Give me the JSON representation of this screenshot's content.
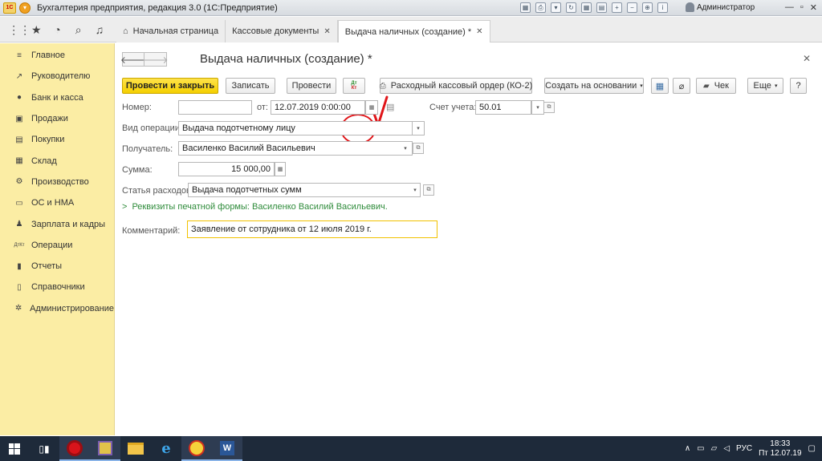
{
  "window": {
    "title": "Бухгалтерия предприятия, редакция 3.0  (1С:Предприятие)",
    "logo_text": "1С",
    "user": "Администратор",
    "controls": [
      "—",
      "▫",
      "✕"
    ]
  },
  "tabs": [
    {
      "label": "Начальная страница"
    },
    {
      "label": "Кассовые документы"
    },
    {
      "label": "Выдача наличных (создание) *"
    }
  ],
  "sidebar": {
    "items": [
      {
        "label": "Главное",
        "icon": "≡"
      },
      {
        "label": "Руководителю",
        "icon": "↗"
      },
      {
        "label": "Банк и касса",
        "icon": "●"
      },
      {
        "label": "Продажи",
        "icon": "▣"
      },
      {
        "label": "Покупки",
        "icon": "▤"
      },
      {
        "label": "Склад",
        "icon": "▦"
      },
      {
        "label": "Производство",
        "icon": "⚙"
      },
      {
        "label": "ОС и НМА",
        "icon": "▭"
      },
      {
        "label": "Зарплата и кадры",
        "icon": "♟"
      },
      {
        "label": "Операции",
        "icon": "ДтКт"
      },
      {
        "label": "Отчеты",
        "icon": "▮"
      },
      {
        "label": "Справочники",
        "icon": "▯"
      },
      {
        "label": "Администрирование",
        "icon": "✲"
      }
    ]
  },
  "form": {
    "title": "Выдача наличных (создание) *",
    "buttons": {
      "post_and_close": "Провести и закрыть",
      "save": "Записать",
      "post": "Провести",
      "dtkt_top": "Дт",
      "dtkt_bottom": "Кт",
      "print_order": "Расходный кассовый ордер (КО-2)",
      "create_based": "Создать на основании",
      "receipt": "Чек",
      "more": "Еще",
      "help": "?"
    },
    "labels": {
      "number": "Номер:",
      "date_from": "от:",
      "account": "Счет учета:",
      "operation_type": "Вид операции:",
      "recipient": "Получатель:",
      "amount": "Сумма:",
      "expense_item": "Статья расходов:",
      "comment": "Комментарий:"
    },
    "values": {
      "number": "",
      "date": "12.07.2019  0:00:00",
      "account": "50.01",
      "operation_type": "Выдача подотчетному лицу",
      "recipient": "Василенко Василий Васильевич",
      "amount": "15 000,00",
      "expense_item": "Выдача подотчетных сумм",
      "comment": "Заявление от сотрудника от 12 июля 2019 г."
    },
    "print_requisites_link": "Реквизиты печатной формы: Василенко Василий Васильевич."
  },
  "annotation": {
    "color": "#e0161a"
  },
  "taskbar": {
    "lang": "РУС",
    "time": "18:33",
    "date": "Пт 12.07.19"
  },
  "colors": {
    "sidebar_bg": "#fbeda4",
    "primary_button": "#f4cf00",
    "link": "#2e8b3a"
  }
}
